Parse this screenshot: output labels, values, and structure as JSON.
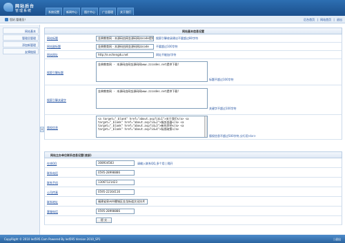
{
  "header": {
    "logo_line1": "网站后台",
    "logo_line2": "管理系统",
    "nav": [
      "系统设置",
      "新闻中心",
      "图片中心",
      "广告管理",
      "关于我们"
    ]
  },
  "topbar": {
    "user": "您好,管理员！",
    "links": [
      "后台首页",
      "|",
      "网站首页",
      "|",
      "退出"
    ]
  },
  "sidebar": {
    "items": [
      "网站基本",
      "管理员管理",
      "添加新管理",
      "友情链接"
    ],
    "collapse_glyph": "«"
  },
  "form1": {
    "title": "网站基本信息设置",
    "rows": [
      {
        "label": "网站标题",
        "value": "金典教育网 - 本源码由网金源码网zzcode提供下载",
        "hint": "搜索引擎收录建议不要超过80字符"
      },
      {
        "label": "网站副标题",
        "value": "金典教育网 - 本源码由网金源码网zzcode",
        "hint": "不要超过100字符"
      },
      {
        "label": "网站网址",
        "value": "http://e.echengdu.net",
        "hint": "网址不能加/字符"
      },
      {
        "label": "搜索引擎标题",
        "value": "金典教育网 - 本源码由网金源码网www.zzcodes.net提供下载!",
        "hint": "标题不超过100字符"
      },
      {
        "label": "搜索引擎关键字",
        "value": "金典教育网 - 本源码由网金源码网www.zzcodes.net提供下载!",
        "hint": "关键字不超过100字符"
      },
      {
        "label": "版权信息",
        "value": "<a target=\"_blank\" href=\"about.asp?id=1\">关于我们</a>  <a target=\"_blank\" href=\"about.asp?id=2\">服务由器</a>  <a target=\"_blank\" href=\"about.asp?id=3\">新的声明</a>  <a target=\"_blank\" href=\"about.asp?id=4\">私隐政策</a>",
        "hint": "版权信息不超过500字符,分行用<br>"
      }
    ]
  },
  "form2": {
    "title": "网站主办单位联系信息设置(底部)",
    "rows": [
      {
        "label": "在线QQ",
        "value": "308934583",
        "hint": "请输入联系QQ,多个用 | 隔开"
      },
      {
        "label": "联系电话",
        "value": "0595-28998886",
        "hint": ""
      },
      {
        "label": "联系手机",
        "value": "13067121423",
        "hint": ""
      },
      {
        "label": "公司传真",
        "value": "0595-22164116",
        "hint": ""
      },
      {
        "label": "联系地址",
        "value": "福建省泉州市鲤城区金龙街道文化技术",
        "hint": ""
      },
      {
        "label": "客服电话",
        "value": "0595-28998886",
        "hint": ""
      }
    ],
    "submit": "提 交"
  },
  "footer": {
    "copyright": "CopyRight © 2010 led595.Com Powered By led595 Version 2010_SP1",
    "right": "| 退出"
  }
}
